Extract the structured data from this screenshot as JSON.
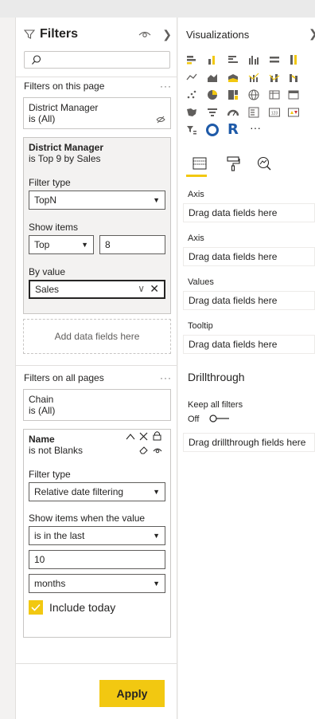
{
  "filters_pane": {
    "title": "Filters",
    "search": {
      "placeholder": ""
    },
    "this_page": {
      "header": "Filters on this page",
      "more": "···",
      "cards": [
        {
          "field": "District Manager",
          "condition": "is (All)"
        },
        {
          "field": "District Manager",
          "condition": "is Top 9 by Sales",
          "filter_type_label": "Filter type",
          "filter_type_value": "TopN",
          "show_items_label": "Show items",
          "show_items_direction": "Top",
          "show_items_count": "8",
          "by_value_label": "By value",
          "by_value_field": "Sales"
        }
      ],
      "add_fields": "Add data fields here"
    },
    "all_pages": {
      "header": "Filters on all pages",
      "more": "···",
      "cards": [
        {
          "field": "Chain",
          "condition": "is (All)"
        },
        {
          "field": "Name",
          "condition": "is not Blanks",
          "filter_type_label": "Filter type",
          "filter_type_value": "Relative date filtering",
          "show_items_label": "Show items when the value",
          "operator": "is in the last",
          "amount": "10",
          "unit": "months",
          "include_today_label": "Include today"
        }
      ]
    },
    "apply_label": "Apply"
  },
  "viz_pane": {
    "title": "Visualizations",
    "more": "···",
    "wells": [
      {
        "label": "Axis",
        "placeholder": "Drag data fields here"
      },
      {
        "label": "Axis",
        "placeholder": "Drag data fields here"
      },
      {
        "label": "Values",
        "placeholder": "Drag data fields here"
      },
      {
        "label": "Tooltip",
        "placeholder": "Drag data fields here"
      }
    ],
    "drillthrough": {
      "title": "Drillthrough",
      "keep_all_filters": "Keep all filters",
      "toggle_state": "Off",
      "drop_placeholder": "Drag drillthrough fields here"
    },
    "r_visual_letter": "R",
    "kpi_text": "123",
    "accent": "#f2c811"
  }
}
